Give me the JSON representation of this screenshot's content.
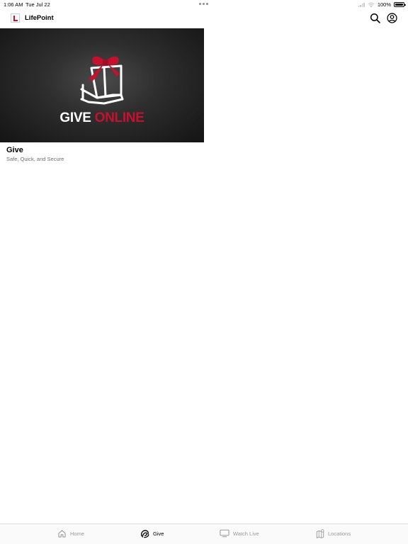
{
  "status_bar": {
    "time": "1:06 AM",
    "date": "Tue Jul 22",
    "battery": "100%",
    "battery_level": 1.0
  },
  "nav": {
    "title": "LifePoint",
    "icons": [
      "logo-icon",
      "search-icon",
      "profile-icon"
    ]
  },
  "card": {
    "image_text": {
      "word1": "GIVE",
      "word2": "ONLINE"
    },
    "title": "Give",
    "subtitle": "Safe, Quick, and Secure"
  },
  "tabs": [
    {
      "label": "Home",
      "icon": "home-icon",
      "active": false
    },
    {
      "label": "Give",
      "icon": "give-icon",
      "active": true
    },
    {
      "label": "Watch Live",
      "icon": "tv-icon",
      "active": false
    },
    {
      "label": "Locations",
      "icon": "map-icon",
      "active": false
    }
  ],
  "colors": {
    "brand_red": "#c8102e",
    "tab_inactive": "#9a9a9a",
    "tab_active": "#000000",
    "subtitle_gray": "#6d6d72"
  }
}
